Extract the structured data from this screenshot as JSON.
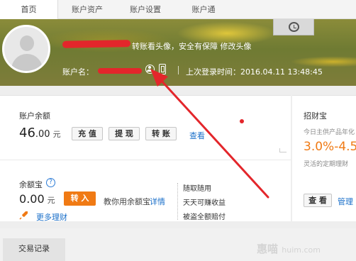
{
  "nav": {
    "tabs": [
      {
        "label": "首页",
        "active": true
      },
      {
        "label": "账户资产",
        "active": false
      },
      {
        "label": "账户设置",
        "active": false
      },
      {
        "label": "账户通",
        "active": false
      }
    ]
  },
  "banner": {
    "avatar_tip": "转账看头像，安全有保障 修改头像",
    "account_label": "账户名：",
    "last_login": "上次登录时间：2016.04.11 13:48:45"
  },
  "balance": {
    "label": "账户余额",
    "amount_int": "46",
    "amount_dec": ".00",
    "unit": "元",
    "buttons": [
      "充 值",
      "提 现",
      "转 账"
    ],
    "view_link": "查看"
  },
  "yuebao": {
    "label": "余额宝",
    "help": "?",
    "amount_int": "0",
    "amount_dec": ".00",
    "unit": "元",
    "transfer_in": "转 入",
    "teach": "教你用余额宝",
    "detail_link": "详情",
    "more_link": "更多理财",
    "features": [
      "随取随用",
      "天天可赚收益",
      "被盗全额赔付"
    ]
  },
  "zhaocaibao": {
    "title": "招财宝",
    "subtitle": "今日主供产品年化",
    "rate": "3.0%-4.5",
    "desc": "灵活的定期理财",
    "view_button": "查 看",
    "manage_link": "管理"
  },
  "bottom": {
    "trade_tab": "交易记录",
    "watermark": "惠喵",
    "watermark_small": "huim.com"
  },
  "colors": {
    "accent_orange": "#f07a14",
    "link_blue": "#1a6fc9",
    "annotation_red": "#e3262b"
  }
}
